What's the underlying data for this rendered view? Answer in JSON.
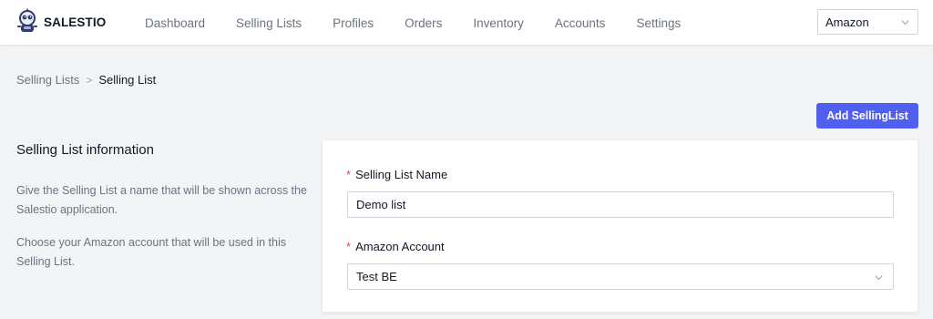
{
  "app": {
    "brand": "SALESTIO"
  },
  "nav": {
    "items": [
      {
        "label": "Dashboard"
      },
      {
        "label": "Selling Lists"
      },
      {
        "label": "Profiles"
      },
      {
        "label": "Orders"
      },
      {
        "label": "Inventory"
      },
      {
        "label": "Accounts"
      },
      {
        "label": "Settings"
      }
    ]
  },
  "marketplace": {
    "selected": "Amazon"
  },
  "breadcrumb": {
    "parent": "Selling Lists",
    "separator": ">",
    "current": "Selling List"
  },
  "actions": {
    "add_label": "Add SellingList",
    "accent_color": "#4f5ff0"
  },
  "info": {
    "title": "Selling List information",
    "paragraph1": "Give the Selling List a name that will be shown across the Salestio application.",
    "paragraph2": "Choose your Amazon account that will be used in this Selling List."
  },
  "form": {
    "required_marker": "*",
    "name_label": "Selling List Name",
    "name_value": "Demo list",
    "account_label": "Amazon Account",
    "account_value": "Test BE"
  },
  "icons": {
    "logo": "robot-logo-icon",
    "dropdown": "chevron-down-icon"
  },
  "colors": {
    "required": "#ef4444",
    "background": "#f3f4f6"
  }
}
